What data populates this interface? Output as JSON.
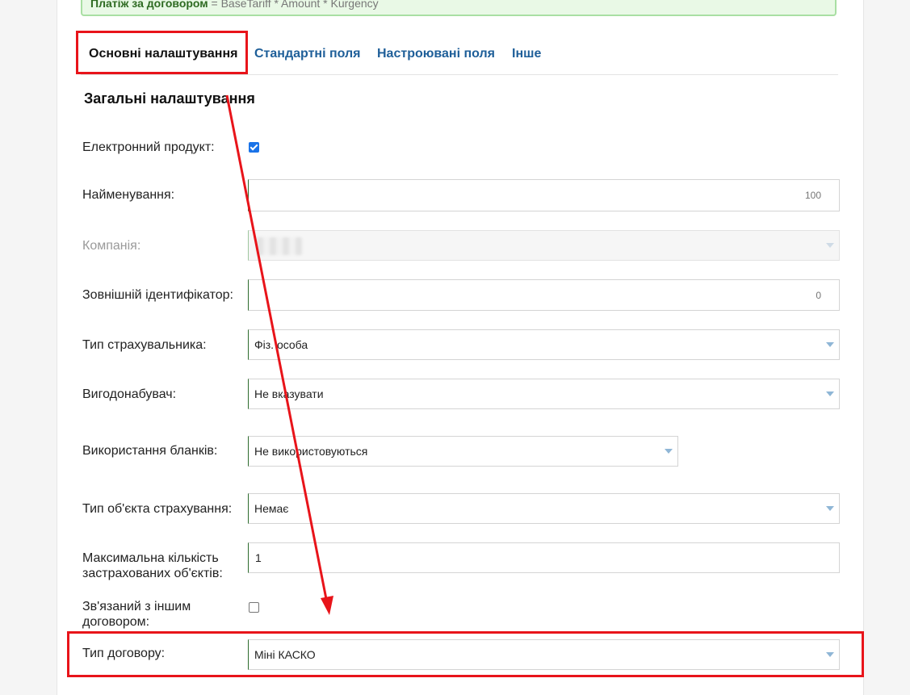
{
  "formula": {
    "label": "Платіж за договором",
    "expr": "= BaseTariff * Amount * Kurgency"
  },
  "tabs": [
    {
      "label": "Основні налаштування",
      "active": true
    },
    {
      "label": "Стандартні поля",
      "active": false
    },
    {
      "label": "Настроювані поля",
      "active": false
    },
    {
      "label": "Інше",
      "active": false
    }
  ],
  "section_title": "Загальні налаштування",
  "fields": {
    "electronic_product": {
      "label": "Електронний продукт:",
      "checked": true
    },
    "name": {
      "label": "Найменування:",
      "value": "",
      "counter": "100"
    },
    "company": {
      "label": "Компанія:",
      "value": "",
      "disabled": true
    },
    "external_id": {
      "label": "Зовнішній ідентифікатор:",
      "value": "",
      "counter": "0"
    },
    "insurer_type": {
      "label": "Тип страхувальника:",
      "value": "Фіз. особа"
    },
    "beneficiary": {
      "label": "Вигодонабувач:",
      "value": "Не вказувати"
    },
    "blanks_usage": {
      "label": "Використання бланків:",
      "value": "Не використовуються"
    },
    "object_type": {
      "label": "Тип об'єкта страхування:",
      "value": "Немає"
    },
    "max_objects": {
      "label_line1": "Максимальна кількість",
      "label_line2": "застрахованих об'єктів:",
      "value": "1"
    },
    "linked_contract": {
      "label_line1": "Зв'язаний з іншим",
      "label_line2": "договором:",
      "checked": false
    },
    "contract_type": {
      "label": "Тип договору:",
      "value": "Міні КАСКО"
    }
  },
  "colors": {
    "accent": "#1f5f99",
    "highlight": "#e8141a",
    "field_border_left": "#2d6b2d",
    "checkbox": "#1a73e8"
  }
}
